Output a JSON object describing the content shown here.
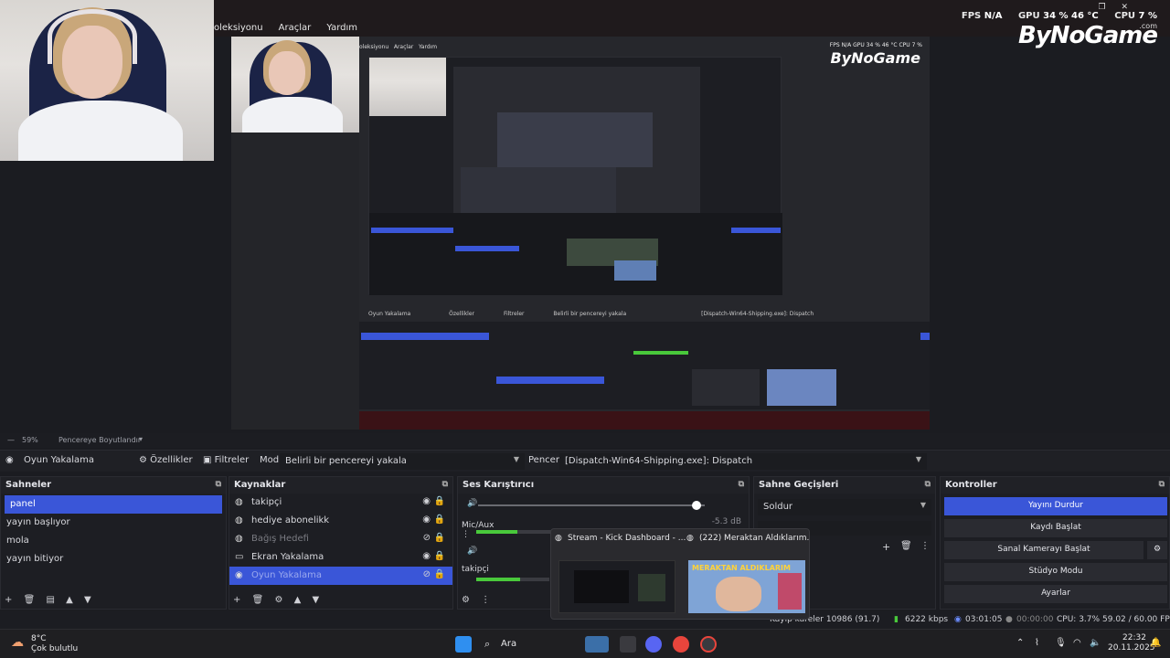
{
  "top": {
    "menu": [
      "oleksiyonu",
      "Araçlar",
      "Yardım"
    ],
    "stats": {
      "fps_label": "FPS",
      "fps_value": "N/A",
      "gpu_label": "GPU",
      "gpu_value": "34 % 46 °C",
      "cpu_label": "CPU",
      "cpu_value": "7 %"
    },
    "brand": "ByNoGame",
    "brand_sub": ".com"
  },
  "preview": {
    "nested_menu": [
      "oleksiyonu",
      "Araçlar",
      "Yardım"
    ],
    "nested_stats": "FPS N/A  GPU 34 % 46 °C  CPU 7 %"
  },
  "zoom": {
    "value": "59%",
    "mode": "Pencereye Boyutlandır"
  },
  "source_bar": {
    "source": "Oyun Yakalama",
    "properties": "Özellikler",
    "filters": "Filtreler",
    "mode_label": "Mod",
    "mode_value": "Belirli bir pencereyi yakala",
    "window_label": "Pencere",
    "window_value": "[Dispatch-Win64-Shipping.exe]: Dispatch"
  },
  "scenes": {
    "title": "Sahneler",
    "items": [
      "panel",
      "yayın başlıyor",
      "mola",
      "yayın bitiyor"
    ],
    "selected": 0
  },
  "sources": {
    "title": "Kaynaklar",
    "items": [
      {
        "label": "takipçi",
        "icon": "browser-icon"
      },
      {
        "label": "hediye abonelikk",
        "icon": "browser-icon"
      },
      {
        "label": "Bağış Hedefi",
        "icon": "browser-icon"
      },
      {
        "label": "Ekran Yakalama",
        "icon": "monitor-icon"
      },
      {
        "label": "Oyun Yakalama",
        "icon": "gamepad-icon"
      }
    ]
  },
  "mixer": {
    "title": "Ses Karıştırıcı",
    "scale": [
      "-60",
      "-55",
      "-50",
      "-45",
      "-40",
      "-35",
      "-30",
      "-25",
      "-20",
      "-15",
      "-10",
      "-5",
      "0"
    ],
    "track1_name": "Mic/Aux",
    "track1_db": "-5.3 dB",
    "track2_name": "takipçi",
    "mic_level": 0.45
  },
  "transitions": {
    "title": "Sahne Geçişleri",
    "value": "Soldur"
  },
  "controls": {
    "title": "Kontroller",
    "buttons": [
      "Yayını Durdur",
      "Kaydı Başlat",
      "Sanal Kamerayı Başlat",
      "Stüdyo Modu",
      "Ayarlar"
    ]
  },
  "status": {
    "dropped": "Kayıp kareler 10986 (91.7)",
    "bitrate": "6222 kbps",
    "stream_time": "03:01:05",
    "rec_time": "00:00:00",
    "cpu": "CPU: 3.7%",
    "fps": "59.02 / 60.00 FPS"
  },
  "thumbnails": {
    "a_title": "Stream - Kick Dashboard - ...",
    "b_title": "(222) Meraktan Aldıklarım...",
    "b_caption": "MERAKTAN ALDIKLARIM"
  },
  "taskbar": {
    "weather_temp": "8°C",
    "weather_desc": "Çok bulutlu",
    "search": "Ara",
    "time": "22:32",
    "date": "20.11.2025"
  }
}
